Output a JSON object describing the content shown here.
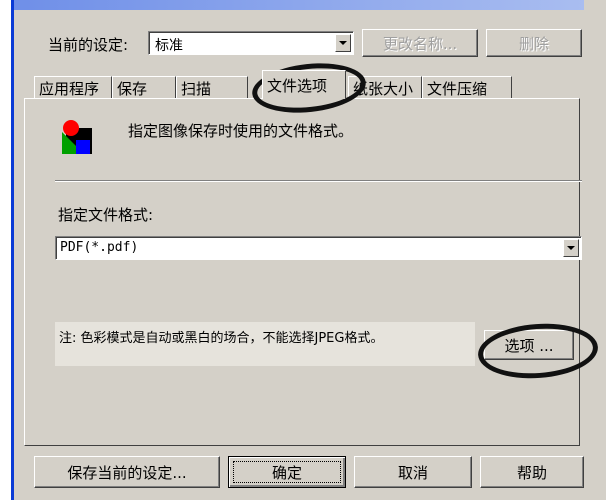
{
  "settings": {
    "current_label": "当前的设定:",
    "current_value": "标准",
    "rename_button": "更改名称...",
    "delete_button": "删除"
  },
  "tabs": [
    {
      "label": "应用程序",
      "active": false
    },
    {
      "label": "保存",
      "active": false
    },
    {
      "label": "扫描",
      "active": false
    },
    {
      "label": "文件选项",
      "active": true
    },
    {
      "label": "纸张大小",
      "active": false
    },
    {
      "label": "文件压缩",
      "active": false
    }
  ],
  "panel": {
    "description": "指定图像保存时使用的文件格式。",
    "format_label": "指定文件格式:",
    "format_value": "PDF(*.pdf)",
    "note": "注: 色彩模式是自动或黑白的场合，不能选择JPEG格式。",
    "options_button": "选项 ..."
  },
  "footer": {
    "save_settings_button": "保存当前的设定...",
    "ok_button": "确定",
    "cancel_button": "取消",
    "help_button": "帮助"
  },
  "colors": {
    "window_bg": "#d4d0c8",
    "title_blue": "#0a3bd6",
    "annotation": "#111111"
  },
  "icons": {
    "file_format_icon": "shapes-icon"
  }
}
